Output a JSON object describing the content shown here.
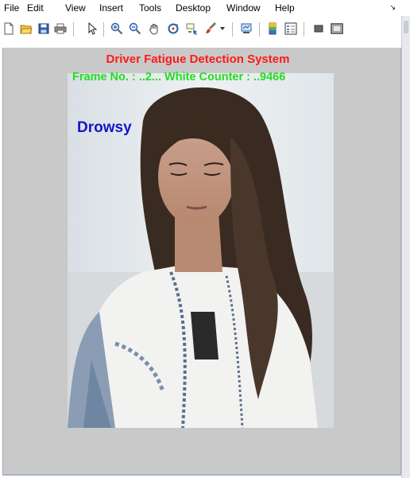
{
  "menubar": {
    "items": [
      "File",
      "Edit",
      "View",
      "Insert",
      "Tools",
      "Desktop",
      "Window",
      "Help"
    ]
  },
  "toolbar": {
    "buttons": [
      "new-figure-icon",
      "open-file-icon",
      "save-icon",
      "print-icon",
      "pointer-icon",
      "zoom-in-icon",
      "zoom-out-icon",
      "pan-icon",
      "rotate-3d-icon",
      "data-cursor-icon",
      "brush-icon",
      "brush-dropdown-icon",
      "link-plot-icon",
      "colorbar-icon",
      "legend-icon",
      "hide-plot-tools-icon",
      "show-plot-tools-icon"
    ]
  },
  "figure": {
    "title": "Driver Fatigue Detection System",
    "frame_info": "Frame No. : ..2... White Counter : ..9466",
    "status_label": "Drowsy",
    "colors": {
      "title": "#ff1a1a",
      "frame_info": "#22dd22",
      "status_label": "#1515c8",
      "background": "#c9c9c9"
    }
  }
}
